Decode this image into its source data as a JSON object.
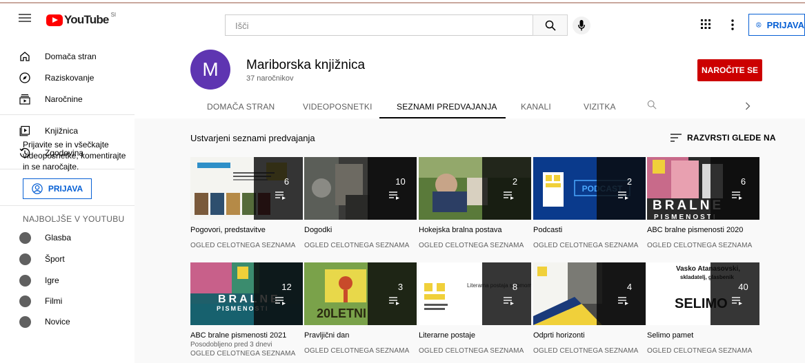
{
  "masthead": {
    "logo_text": "YouTube",
    "logo_country": "SI",
    "search_placeholder": "Išči",
    "signin_label": "PRIJAVA"
  },
  "sidebar": {
    "items": [
      {
        "label": "Domača stran",
        "icon": "home-icon"
      },
      {
        "label": "Raziskovanje",
        "icon": "compass-icon"
      },
      {
        "label": "Naročnine",
        "icon": "subscriptions-icon"
      },
      {
        "label": "Knjižnica",
        "icon": "library-icon"
      },
      {
        "label": "Zgodovina",
        "icon": "history-icon"
      }
    ],
    "signin_message": "Prijavite se in všečkajte videoposnetke, komentirajte in se naročajte.",
    "signin_label": "PRIJAVA",
    "best_title": "NAJBOLJŠE V YOUTUBU",
    "best_items": [
      {
        "label": "Glasba",
        "icon": "music-icon"
      },
      {
        "label": "Šport",
        "icon": "trophy-icon"
      },
      {
        "label": "Igre",
        "icon": "gaming-icon"
      },
      {
        "label": "Filmi",
        "icon": "movies-icon"
      },
      {
        "label": "Novice",
        "icon": "news-icon"
      }
    ]
  },
  "channel": {
    "avatar_letter": "M",
    "name": "Mariborska knjižnica",
    "subscribers": "37 naročnikov",
    "subscribe_label": "NAROČITE SE",
    "tabs": [
      "DOMAČA STRAN",
      "VIDEOPOSNETKI",
      "SEZNAMI PREDVAJANJA",
      "KANALI",
      "VIZITKA"
    ],
    "active_tab": "SEZNAMI PREDVAJANJA"
  },
  "playlists": {
    "section_title": "Ustvarjeni seznami predvajanja",
    "sort_label": "RAZVRSTI GLEDE NA",
    "view_all_label": "OGLED CELOTNEGA SEZNAMA",
    "items": [
      {
        "title": "Pogovori, predstavitve",
        "count": "6"
      },
      {
        "title": "Dogodki",
        "count": "10"
      },
      {
        "title": "Hokejska bralna postava",
        "count": "2"
      },
      {
        "title": "Podcasti",
        "count": "2"
      },
      {
        "title": "ABC bralne pismenosti 2020",
        "count": "6"
      },
      {
        "title": "ABC bralne pismenosti 2021",
        "count": "12",
        "updated": "Posodobljeno pred 3 dnevi"
      },
      {
        "title": "Pravljični dan",
        "count": "3"
      },
      {
        "title": "Literarne postaje",
        "count": "8"
      },
      {
        "title": "Odprti horizonti",
        "count": "4"
      },
      {
        "title": "Selimo pamet",
        "count": "40"
      }
    ]
  },
  "thumb_text": {
    "podcast": "PODCAST",
    "bralne": "BRALNE",
    "pismenosti": "PISMENOSTI",
    "jubilee": "20LETNI",
    "literarne": "Literarna postaja s Tomom Podstenškom",
    "selimo_name": "Vasko Atanasovski,",
    "selimo_role": "skladatelj, glasbenik",
    "selimo_logo": "SELIMO"
  },
  "colors": {
    "accent_blue": "#065fd4",
    "subscribe_red": "#cc0000",
    "avatar_purple": "#5e35b1"
  }
}
